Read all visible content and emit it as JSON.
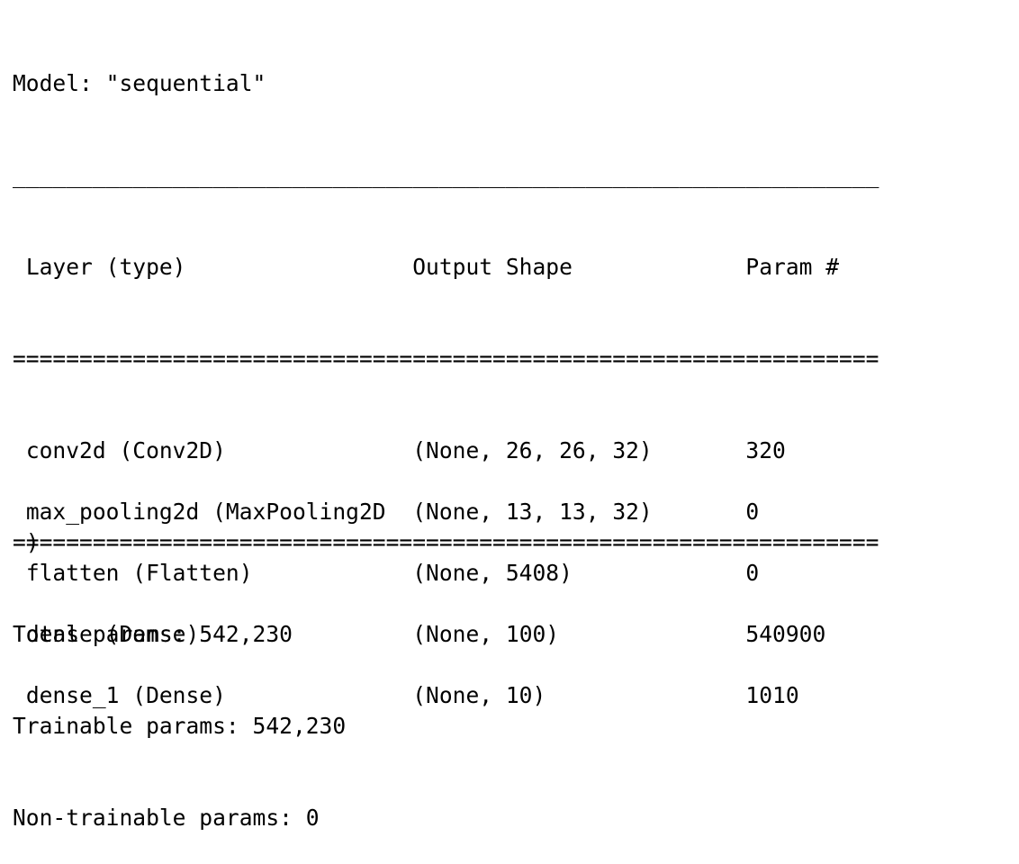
{
  "model_line": "Model: \"sequential\"",
  "top_rule": "_________________________________________________________________",
  "header": {
    "layer": "Layer (type)",
    "output_shape": "Output Shape",
    "params": "Param #"
  },
  "double_rule": "=================================================================",
  "layers": [
    {
      "name": "conv2d (Conv2D)",
      "name_cont": "",
      "output_shape": "(None, 26, 26, 32)",
      "params": "320"
    },
    {
      "name": "max_pooling2d (MaxPooling2D",
      "name_cont": ")",
      "output_shape": "(None, 13, 13, 32)",
      "params": "0"
    },
    {
      "name": "flatten (Flatten)",
      "name_cont": "",
      "output_shape": "(None, 5408)",
      "params": "0"
    },
    {
      "name": "dense (Dense)",
      "name_cont": "",
      "output_shape": "(None, 100)",
      "params": "540900"
    },
    {
      "name": "dense_1 (Dense)",
      "name_cont": "",
      "output_shape": "(None, 10)",
      "params": "1010"
    }
  ],
  "totals": {
    "total": "Total params: 542,230",
    "trainable": "Trainable params: 542,230",
    "non_trainable": "Non-trainable params: 0"
  }
}
